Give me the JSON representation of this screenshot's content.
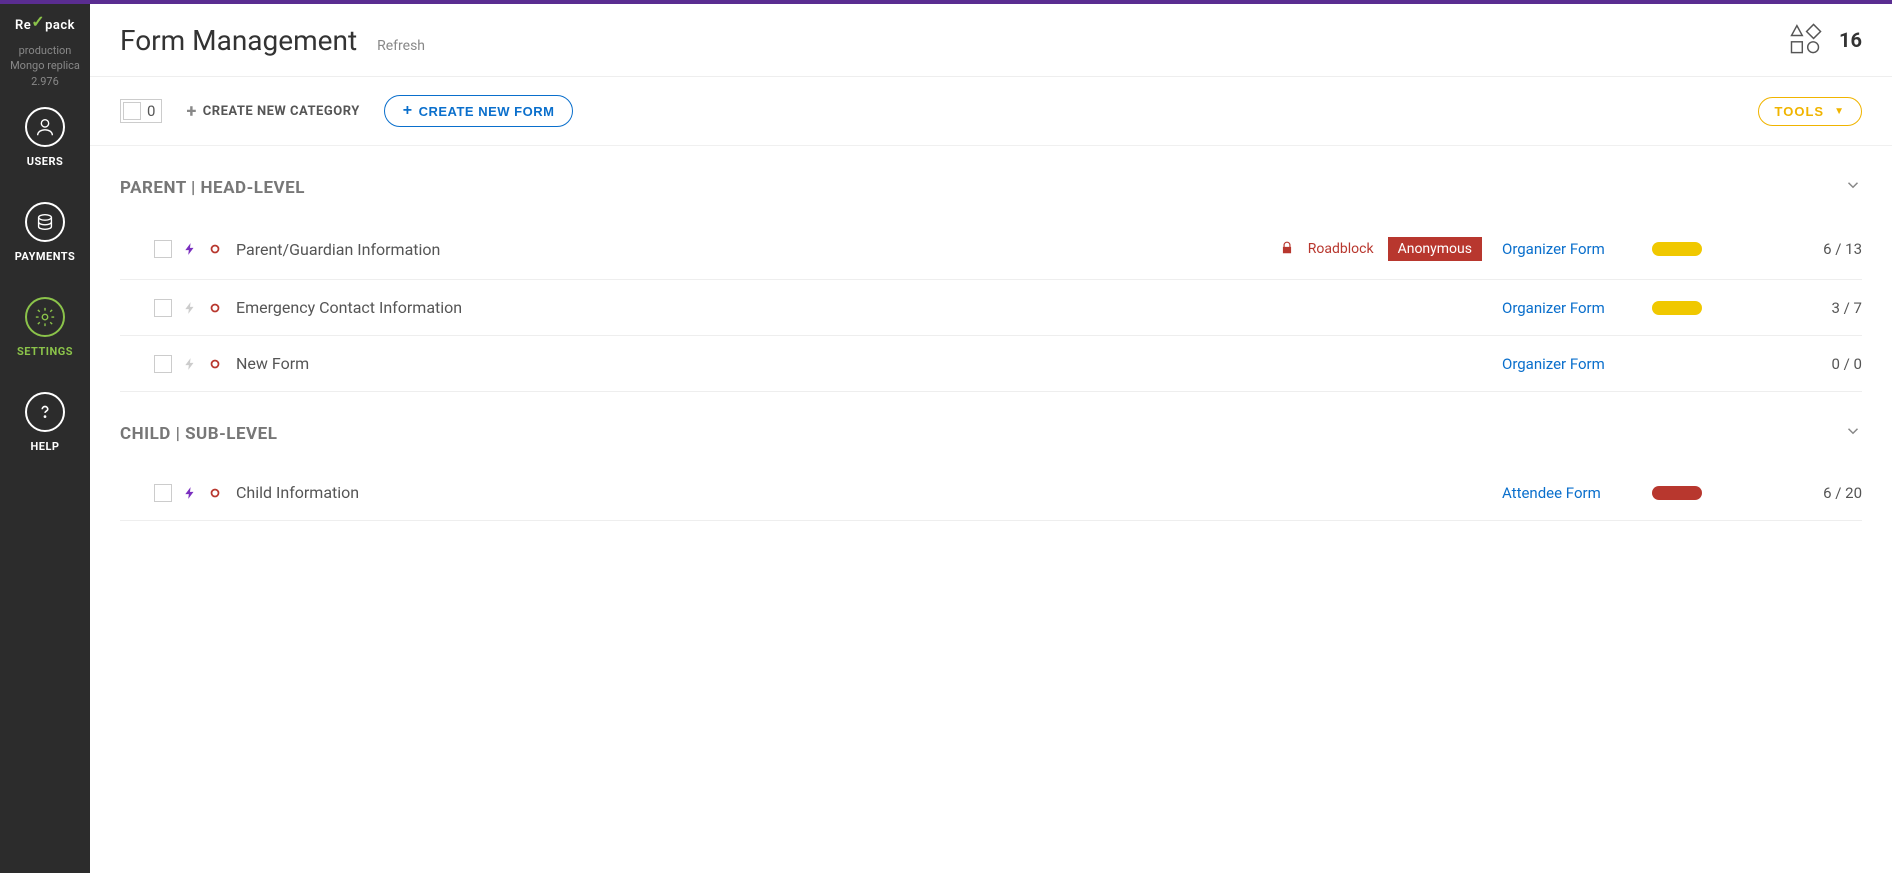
{
  "sidebar": {
    "logo": "Regpack",
    "env": {
      "line1": "production",
      "line2": "Mongo replica",
      "line3": "2.976"
    },
    "items": [
      {
        "label": "USERS"
      },
      {
        "label": "PAYMENTS"
      },
      {
        "label": "SETTINGS"
      },
      {
        "label": "HELP"
      }
    ]
  },
  "header": {
    "title": "Form Management",
    "refresh": "Refresh",
    "count": "16"
  },
  "toolbar": {
    "selected_count": "0",
    "create_category": "CREATE NEW CATEGORY",
    "create_form": "CREATE NEW FORM",
    "tools": "TOOLS"
  },
  "sections": [
    {
      "title": "PARENT | HEAD-LEVEL",
      "rows": [
        {
          "name": "Parent/Guardian Information",
          "bolt_active": true,
          "locked": true,
          "roadblock": "Roadblock",
          "anonymous": "Anonymous",
          "form_type": "Organizer Form",
          "pill": "yellow",
          "progress": "6 / 13"
        },
        {
          "name": "Emergency Contact Information",
          "bolt_active": false,
          "locked": false,
          "form_type": "Organizer Form",
          "pill": "yellow",
          "progress": "3 / 7"
        },
        {
          "name": "New Form",
          "bolt_active": false,
          "locked": false,
          "form_type": "Organizer Form",
          "pill": "none",
          "progress": "0 / 0"
        }
      ]
    },
    {
      "title": "CHILD | SUB-LEVEL",
      "rows": [
        {
          "name": "Child Information",
          "bolt_active": true,
          "locked": false,
          "form_type": "Attendee Form",
          "pill": "red",
          "progress": "6 / 20"
        }
      ]
    }
  ]
}
